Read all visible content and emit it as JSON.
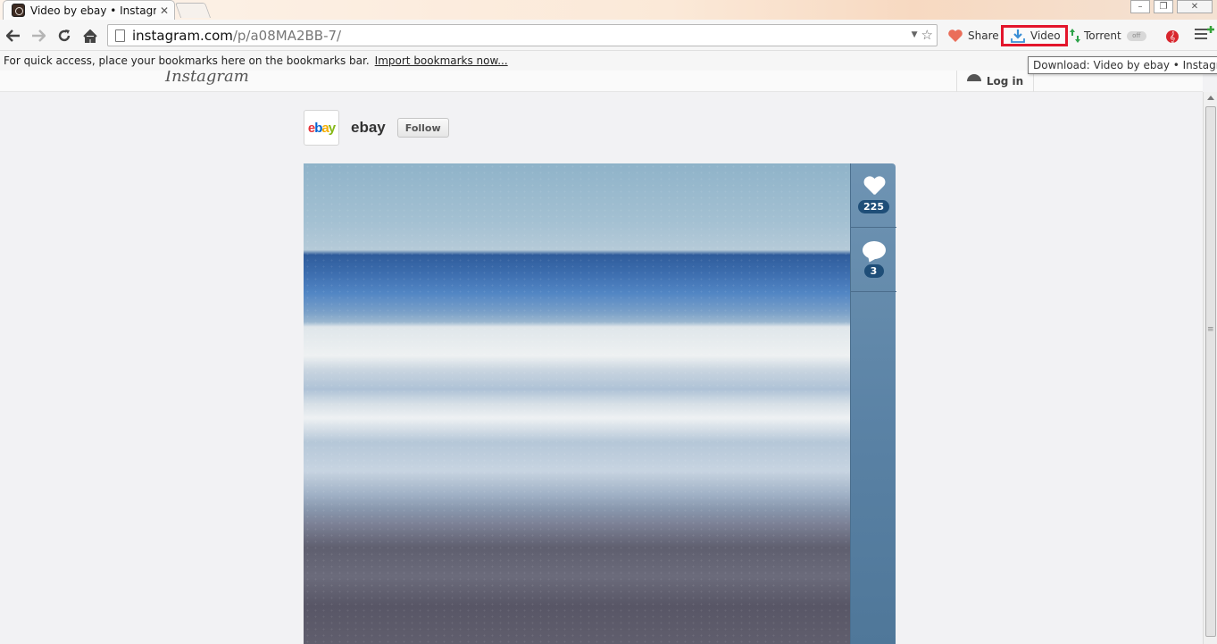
{
  "browser": {
    "tab_title": "Video by ebay • Instagram",
    "tab_close": "✕",
    "url_host": "instagram.com",
    "url_path": "/p/a08MA2BB-7/",
    "window_controls": [
      "–",
      "❐",
      "✕"
    ]
  },
  "extensions": {
    "share_label": "Share",
    "video_label": "Video",
    "torrent_label": "Torrent",
    "torrent_toggle": "off",
    "tooltip": "Download: Video by ebay • Instagram",
    "highlight_color": "#e3152b"
  },
  "bookmarks_bar": {
    "message": "For quick access, place your bookmarks here on the bookmarks bar.",
    "import_link": "Import bookmarks now..."
  },
  "instagram": {
    "logo": "Instagram",
    "login_label": "Log in",
    "post": {
      "username": "ebay",
      "follow_label": "Follow",
      "likes": "225",
      "comments": "3"
    }
  }
}
